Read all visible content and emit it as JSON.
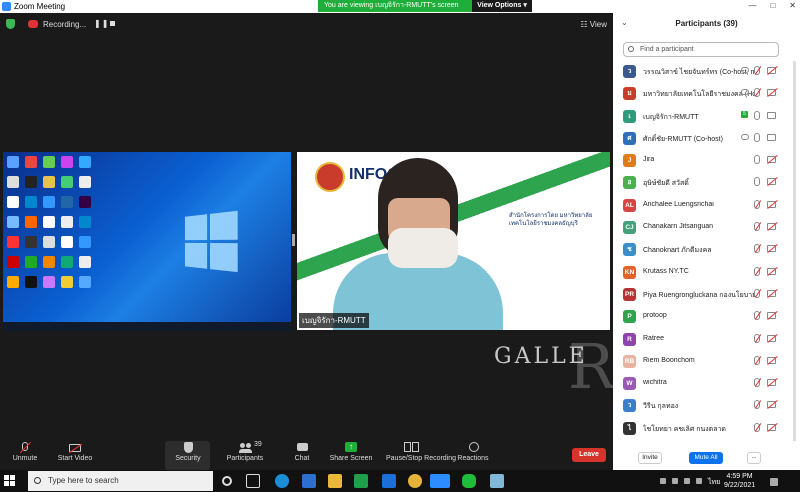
{
  "window": {
    "title": "Zoom Meeting",
    "min": "—",
    "max": "□",
    "close": "✕"
  },
  "banner": {
    "message": "You are viewing เบญจิรักา-RMUTT's screen",
    "options_label": "View Options ▾"
  },
  "meeting_bar": {
    "recording_label": "Recording...",
    "pause": "❚❚",
    "view_label": "☷ View"
  },
  "share": {
    "name_label": "เบญจิรักา-RMUTT",
    "infog_title": "INFOG",
    "thai_heading": "สำนักโครงการโดย มหาวิทยาลัยเทคโนโลยีราชมงคลธัญบุรี"
  },
  "watermark": {
    "text": "GALLE",
    "big_letter": "R"
  },
  "toolbar": {
    "items": [
      {
        "label": "Unmute",
        "icon": "mic-muted-icon"
      },
      {
        "label": "Start Video",
        "icon": "video-off-icon"
      },
      {
        "label": "Security",
        "icon": "shield-icon"
      },
      {
        "label": "Participants",
        "icon": "participants-icon",
        "count": "39"
      },
      {
        "label": "Chat",
        "icon": "chat-icon"
      },
      {
        "label": "Share Screen",
        "icon": "share-screen-icon"
      },
      {
        "label": "Pause/Stop Recording",
        "icon": "pause-recording-icon"
      },
      {
        "label": "Reactions",
        "icon": "reactions-icon"
      }
    ],
    "leave_label": "Leave"
  },
  "panel": {
    "title": "Participants (39)",
    "close": "⌄",
    "search_placeholder": "Find a participant",
    "participants": [
      {
        "initials": "ว",
        "name": "วรรณวิสาข์ ไชยจันทร์ทร (Co-host, me)",
        "color": "#3b5a8f",
        "mic": "muted",
        "cam": "off",
        "cloud": true
      },
      {
        "initials": "ม",
        "name": "มหาวิทยาลัยเทคโนโลยีราชมงคล (Host)",
        "color": "#c93b2a",
        "mic": "muted",
        "cam": "off",
        "cloud": true
      },
      {
        "initials": "เ",
        "name": "เบญจิรักา-RMUTT",
        "color": "#2e9c7a",
        "mic": "on",
        "cam": "on",
        "badge": "5"
      },
      {
        "initials": "ศ",
        "name": "ศักดิ์ชัย-RMUTT (Co-host)",
        "color": "#2e6fb8",
        "mic": "on",
        "cam": "on",
        "cloud": true
      },
      {
        "initials": "J",
        "name": "Jira",
        "color": "#e07b1a",
        "mic": "on",
        "cam": "off"
      },
      {
        "initials": "อ",
        "name": "อุษิษ์ชัยดี สวัสดิ์",
        "color": "#4caf50",
        "mic": "on",
        "cam": "off"
      },
      {
        "initials": "AL",
        "name": "Anchalee Luengsrichai",
        "color": "#d84343",
        "mic": "muted",
        "cam": "off"
      },
      {
        "initials": "CJ",
        "name": "Chanakarn Jitsanguan",
        "color": "#43a07a",
        "mic": "muted",
        "cam": "off"
      },
      {
        "initials": "ช",
        "name": "Chanoknart ภักดีมงคล",
        "color": "#3b8fc9",
        "mic": "muted",
        "cam": "off"
      },
      {
        "initials": "KN",
        "name": "Krutass NY.TC",
        "color": "#e0642a",
        "mic": "muted",
        "cam": "off"
      },
      {
        "initials": "PR",
        "name": "Piya Ruengrongluckana กองนโยบาย",
        "color": "#b83232",
        "mic": "muted",
        "cam": "off"
      },
      {
        "initials": "P",
        "name": "protoop",
        "color": "#2ea44f",
        "mic": "muted",
        "cam": "off"
      },
      {
        "initials": "R",
        "name": "Ratree",
        "color": "#8e44ad",
        "mic": "muted",
        "cam": "off"
      },
      {
        "initials": "RB",
        "name": "Riem Boonchom",
        "color": "#e8b4a0",
        "mic": "muted",
        "cam": "off"
      },
      {
        "initials": "W",
        "name": "wichitra",
        "color": "#9b59b6",
        "mic": "muted",
        "cam": "off"
      },
      {
        "initials": "ว",
        "name": "วีรีน กุลทอง",
        "color": "#3b7fc9",
        "mic": "muted",
        "cam": "off"
      },
      {
        "initials": "ไ",
        "name": "ไชโยทยา คชเลิศ กนงตลาด",
        "color": "#333333",
        "mic": "muted",
        "cam": "off"
      }
    ],
    "invite": "Invite",
    "mute_all": "Mute All",
    "more": "..."
  },
  "taskbar": {
    "search_placeholder": "Type here to search",
    "lang": "ไทย",
    "time": "4:59 PM",
    "date": "9/22/2021"
  }
}
